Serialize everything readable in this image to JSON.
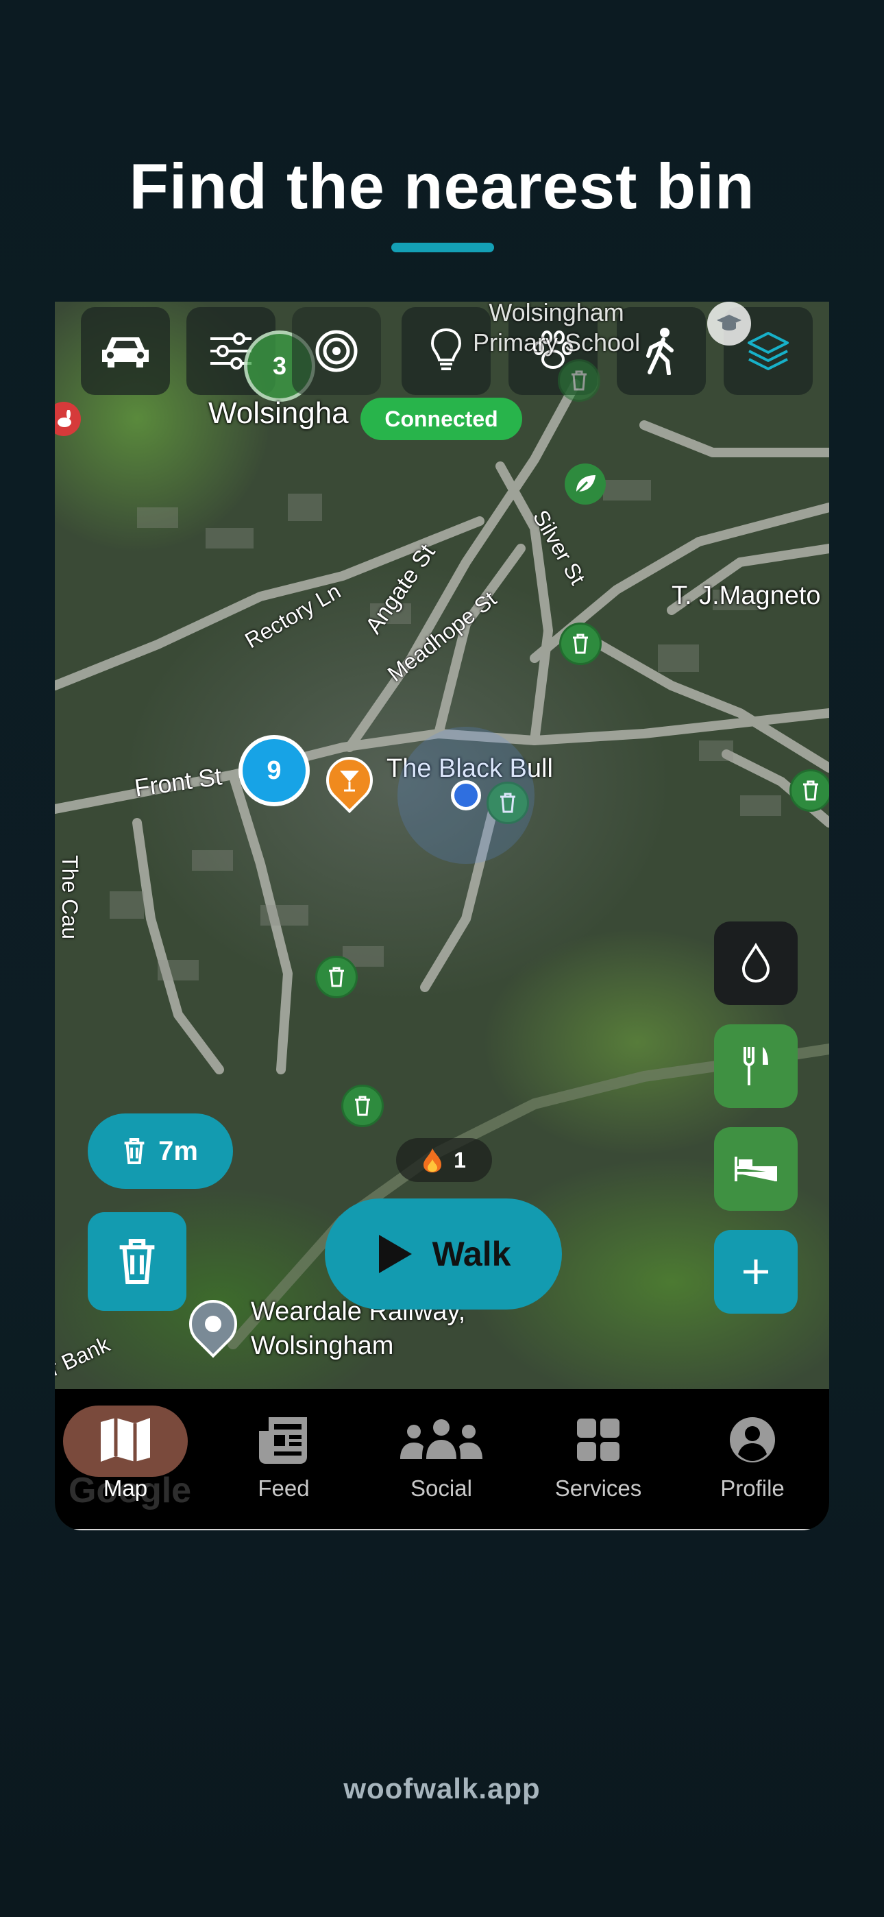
{
  "headline": "Find the nearest bin",
  "map": {
    "top_controls": [
      {
        "name": "car-icon"
      },
      {
        "name": "filter-sliders-icon"
      },
      {
        "name": "target-icon"
      },
      {
        "name": "lightbulb-icon"
      },
      {
        "name": "paw-icon"
      },
      {
        "name": "walking-person-icon"
      },
      {
        "name": "layers-icon"
      }
    ],
    "partial_cluster_count": "3",
    "connection_status": "Connected",
    "place_labels": {
      "school": "Wolsingham\nPrimary School",
      "town": "Wolsingha",
      "pub": "The Black Bull",
      "business": "T. J.Magneto",
      "railway": "Weardale Railway,\nWolsingham"
    },
    "street_labels": {
      "rectory": "Rectory Ln",
      "angate": "Angate St",
      "meadhope": "Meadhope St",
      "silver": "Silver St",
      "front": "Front St",
      "causeway": "The Cau",
      "bank": "r Bank"
    },
    "cluster_count": "9",
    "attribution": "Google",
    "streak_count": "1",
    "nearest_bin_distance": "7m",
    "walk_button_label": "Walk",
    "side_buttons": [
      {
        "name": "water-drop-icon",
        "color": "#1b1e1f"
      },
      {
        "name": "fork-knife-icon",
        "color": "#3f9142"
      },
      {
        "name": "bed-icon",
        "color": "#3f9142"
      },
      {
        "name": "plus-icon",
        "color": "#139bb0"
      }
    ]
  },
  "nav": {
    "items": [
      {
        "label": "Map",
        "icon": "map-icon",
        "active": true
      },
      {
        "label": "Feed",
        "icon": "newspaper-icon"
      },
      {
        "label": "Social",
        "icon": "people-group-icon"
      },
      {
        "label": "Services",
        "icon": "grid-icon"
      },
      {
        "label": "Profile",
        "icon": "user-circle-icon"
      }
    ]
  },
  "colors": {
    "accent": "#14a0b6",
    "bin_green": "#2e8b3e",
    "active_tab": "#7a4a3c",
    "connected": "#28b44b"
  },
  "footer": "woofwalk.app"
}
